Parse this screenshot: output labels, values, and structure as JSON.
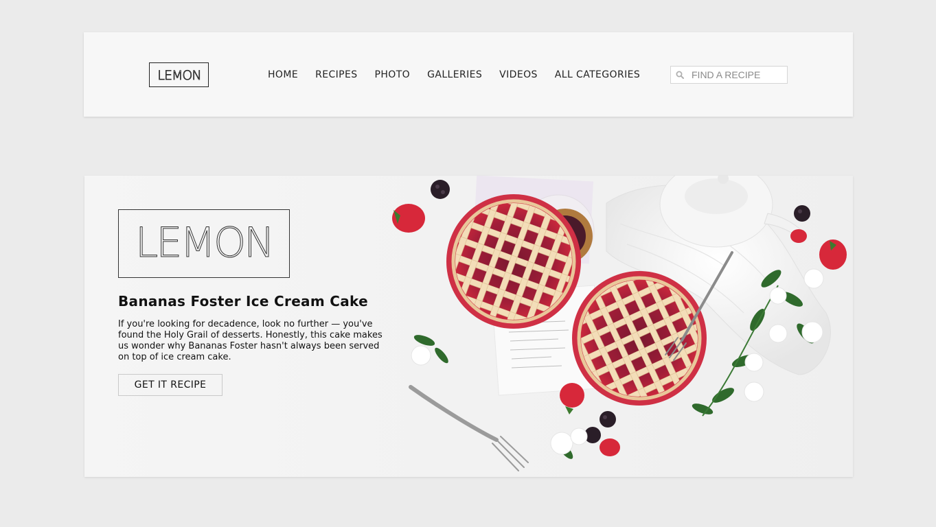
{
  "header": {
    "logo_text": "LEMON",
    "nav": [
      {
        "label": "HOME"
      },
      {
        "label": "RECIPES"
      },
      {
        "label": "PHOTO"
      },
      {
        "label": "GALLERIES"
      },
      {
        "label": "VIDEOS"
      },
      {
        "label": "ALL CATEGORIES"
      }
    ],
    "search": {
      "placeholder": "FIND A RECIPE",
      "icon": "search-icon"
    }
  },
  "hero": {
    "logo_text": "LEMON",
    "title": "Bananas Foster Ice Cream Cake",
    "description": "If you're looking for decadence, look no further — you've found the Holy Grail of desserts. Honestly, this cake makes us wonder why Bananas Foster hasn't always been served on top of ice cream cake.",
    "button_label": "GET IT RECIPE"
  },
  "colors": {
    "page_background": "#ebebeb",
    "card_background": "#f7f7f7",
    "text": "#111111",
    "pie_red": "#c8283c",
    "crust": "#f2dcb8"
  }
}
